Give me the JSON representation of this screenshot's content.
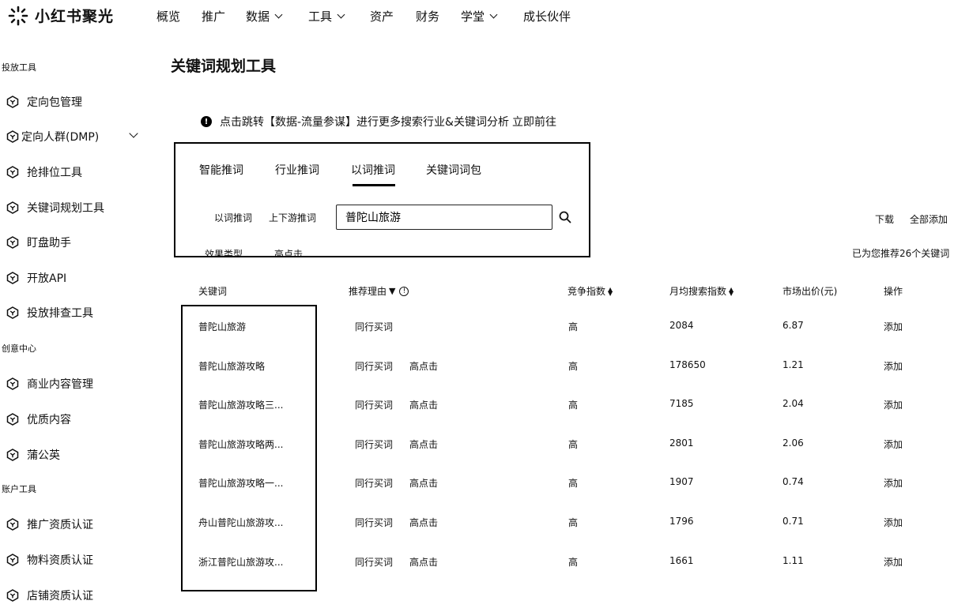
{
  "brand": {
    "name": "小红书聚光"
  },
  "nav": [
    {
      "label": "概览",
      "dropdown": false
    },
    {
      "label": "推广",
      "dropdown": false
    },
    {
      "label": "数据",
      "dropdown": true
    },
    {
      "label": "工具",
      "dropdown": true
    },
    {
      "label": "资产",
      "dropdown": false
    },
    {
      "label": "财务",
      "dropdown": false
    },
    {
      "label": "学堂",
      "dropdown": true
    },
    {
      "label": "成长伙伴",
      "dropdown": false
    }
  ],
  "sidebar": {
    "sections": [
      "投放工具",
      "创意中心",
      "账户工具"
    ],
    "items": [
      "定向包管理",
      "定向人群(DMP)",
      "抢排位工具",
      "关键词规划工具",
      "盯盘助手",
      "开放API",
      "投放排查工具",
      "商业内容管理",
      "优质内容",
      "蒲公英",
      "推广资质认证",
      "物料资质认证",
      "店铺资质认证"
    ]
  },
  "page": {
    "title": "关键词规划工具",
    "notice": "点击跳转【数据-流量参谋】进行更多搜索行业&关键词分析",
    "notice_link": "立即前往"
  },
  "tabs": [
    "智能推词",
    "行业推词",
    "以词推词",
    "关键词词包"
  ],
  "active_tab": "以词推词",
  "sub_tabs": [
    "以词推词",
    "上下游推词"
  ],
  "search": {
    "value": "普陀山旅游",
    "icon": "search-icon"
  },
  "filters": [
    "效果类型",
    "高点击"
  ],
  "actions": {
    "download": "下载",
    "add_all": "全部添加"
  },
  "recommend_count": "已为您推荐26个关键词",
  "table": {
    "headers": [
      "关键词",
      "推荐理由",
      "竞争指数",
      "月均搜索指数",
      "市场出价(元)",
      "操作"
    ],
    "rows": [
      {
        "keyword": "普陀山旅游",
        "reasons": [
          "同行买词"
        ],
        "competition": "高",
        "monthly_search": "2084",
        "bid": "6.87",
        "action": "添加"
      },
      {
        "keyword": "普陀山旅游攻略",
        "reasons": [
          "同行买词",
          "高点击"
        ],
        "competition": "高",
        "monthly_search": "178650",
        "bid": "1.21",
        "action": "添加"
      },
      {
        "keyword": "普陀山旅游攻略三...",
        "reasons": [
          "同行买词",
          "高点击"
        ],
        "competition": "高",
        "monthly_search": "7185",
        "bid": "2.04",
        "action": "添加"
      },
      {
        "keyword": "普陀山旅游攻略两...",
        "reasons": [
          "同行买词",
          "高点击"
        ],
        "competition": "高",
        "monthly_search": "2801",
        "bid": "2.06",
        "action": "添加"
      },
      {
        "keyword": "普陀山旅游攻略一...",
        "reasons": [
          "同行买词",
          "高点击"
        ],
        "competition": "高",
        "monthly_search": "1907",
        "bid": "0.74",
        "action": "添加"
      },
      {
        "keyword": "舟山普陀山旅游攻...",
        "reasons": [
          "同行买词",
          "高点击"
        ],
        "competition": "高",
        "monthly_search": "1796",
        "bid": "0.71",
        "action": "添加"
      },
      {
        "keyword": "浙江普陀山旅游攻...",
        "reasons": [
          "同行买词",
          "高点击"
        ],
        "competition": "高",
        "monthly_search": "1661",
        "bid": "1.11",
        "action": "添加"
      }
    ]
  }
}
